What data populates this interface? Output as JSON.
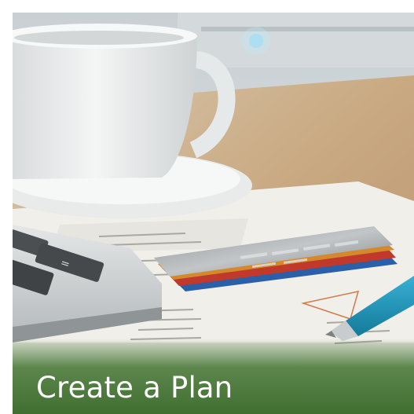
{
  "tile": {
    "title": "Create a Plan"
  },
  "colors": {
    "caption_green": "#3d7a2c",
    "pen_blue": "#1f93b5",
    "card_red": "#c0392b"
  }
}
